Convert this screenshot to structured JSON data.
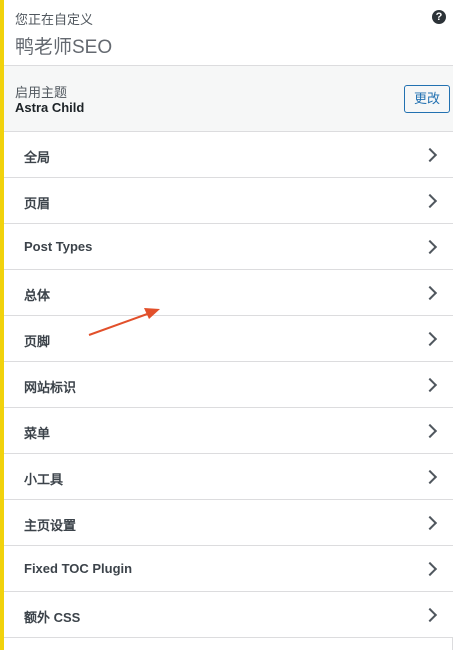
{
  "header": {
    "customizing_label": "您正在自定义",
    "site_title": "鸭老师SEO",
    "help_icon": "question-circle-icon"
  },
  "theme": {
    "caption": "启用主题",
    "name": "Astra Child",
    "change_label": "更改"
  },
  "menu": {
    "items": [
      {
        "label": "全局"
      },
      {
        "label": "页眉"
      },
      {
        "label": "Post Types"
      },
      {
        "label": "总体"
      },
      {
        "label": "页脚"
      },
      {
        "label": "网站标识"
      },
      {
        "label": "菜单"
      },
      {
        "label": "小工具"
      },
      {
        "label": "主页设置"
      },
      {
        "label": "Fixed TOC Plugin"
      },
      {
        "label": "额外 CSS"
      }
    ],
    "chevron_icon": "chevron-right-icon"
  },
  "colors": {
    "accent": "#f1d20c",
    "link": "#2271b1",
    "annotation_arrow": "#e2502b"
  }
}
